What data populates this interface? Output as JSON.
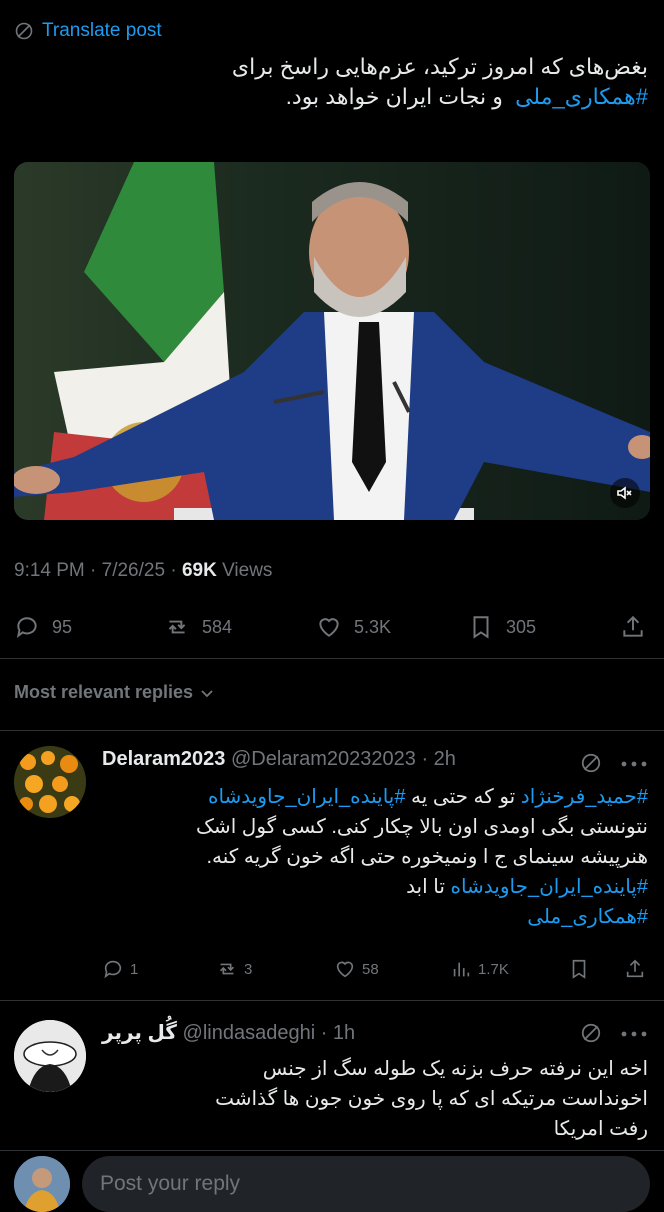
{
  "translate": {
    "label": "Translate post"
  },
  "post": {
    "lines": [
      "بغض‌های که امروز ترکید، عزم‌هایی راسخ برای",
      "و نجات ایران خواهد بود."
    ],
    "hashtag": "#همکاری_ملی",
    "timestamp": "9:14 PM · 7/26/25 ·",
    "views_count": "69K",
    "views_label": "Views"
  },
  "actions": {
    "replies": "95",
    "reposts": "584",
    "likes": "5.3K",
    "bookmarks": "305"
  },
  "replies_filter": {
    "label": "Most relevant replies"
  },
  "replies": [
    {
      "name": "Delaram2023",
      "handle": "@Delaram20232023",
      "time": "· 2h",
      "hashtag_line1_a": "#حمید_فرخنژاد",
      "line1_mid": " تو که حتی یه ",
      "hashtag_line1_b": "#پاینده_ایران_جاویدشاه",
      "line2": "نتونستی بگی اومدی اون بالا چکار کنی. کسی گول اشک",
      "line3": "هنرپیشه سینمای ج ا ونمیخوره حتی اگه خون گریه کنه.",
      "hashtag_line4": "#پاینده_ایران_جاویدشاه",
      "line4_tail": " تا ابد",
      "hashtag_line5": "#همکاری_ملی",
      "replies": "1",
      "reposts": "3",
      "likes": "58",
      "views": "1.7K"
    },
    {
      "name": "گُل پرپر",
      "handle": "@lindasadeghi",
      "time": "· 1h",
      "line1": "اخه این نرفته حرف بزنه یک طوله سگ از جنس",
      "line2": "اخونداست مرتیکه ای که پا روی خون جون ها گذاشت",
      "line3": "رفت امریکا"
    }
  ],
  "composer": {
    "placeholder": "Post your reply"
  }
}
